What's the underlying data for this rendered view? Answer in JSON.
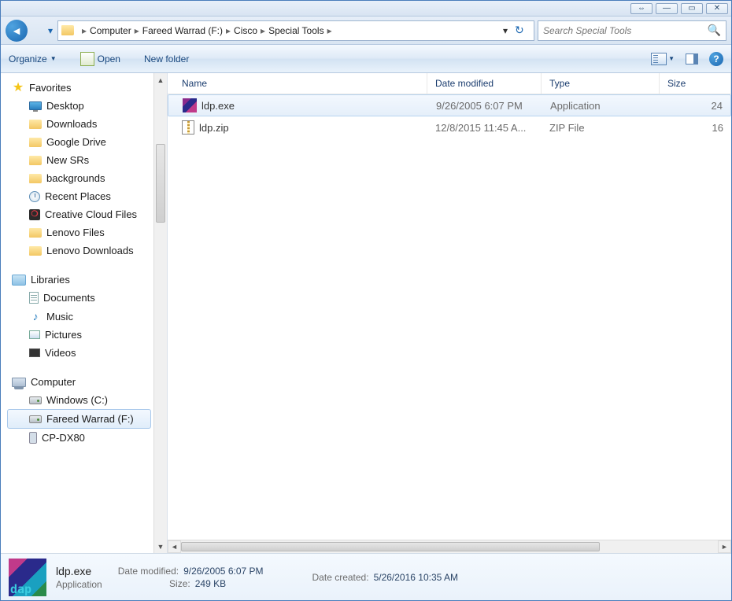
{
  "window": {
    "controls": {
      "expand": "⇔",
      "min": "—",
      "max": "▭",
      "close": "✕"
    }
  },
  "address": {
    "breadcrumbs": [
      "Computer",
      "Fareed Warrad (F:)",
      "Cisco",
      "Special Tools"
    ],
    "drop": "▾",
    "refresh": "↻"
  },
  "search": {
    "placeholder": "Search Special Tools",
    "icon": "🔍"
  },
  "toolbar": {
    "organize": "Organize",
    "open": "Open",
    "newfolder": "New folder",
    "drop": "▼"
  },
  "columns": {
    "name": "Name",
    "date": "Date modified",
    "type": "Type",
    "size": "Size"
  },
  "files": [
    {
      "name": "ldp.exe",
      "date": "9/26/2005 6:07 PM",
      "type": "Application",
      "size": "24",
      "selected": true,
      "icon": "ldp"
    },
    {
      "name": "ldp.zip",
      "date": "12/8/2015 11:45 A...",
      "type": "ZIP File",
      "size": "16",
      "selected": false,
      "icon": "zip"
    }
  ],
  "nav": {
    "favorites": {
      "label": "Favorites",
      "items": [
        {
          "label": "Desktop",
          "icon": "desktop"
        },
        {
          "label": "Downloads",
          "icon": "folder"
        },
        {
          "label": "Google Drive",
          "icon": "folder"
        },
        {
          "label": "New SRs",
          "icon": "folder"
        },
        {
          "label": "backgrounds",
          "icon": "folder"
        },
        {
          "label": "Recent Places",
          "icon": "recent"
        },
        {
          "label": "Creative Cloud Files",
          "icon": "cc"
        },
        {
          "label": "Lenovo Files",
          "icon": "folder"
        },
        {
          "label": "Lenovo Downloads",
          "icon": "folder"
        }
      ]
    },
    "libraries": {
      "label": "Libraries",
      "items": [
        {
          "label": "Documents",
          "icon": "doc"
        },
        {
          "label": "Music",
          "icon": "music"
        },
        {
          "label": "Pictures",
          "icon": "pic"
        },
        {
          "label": "Videos",
          "icon": "vid"
        }
      ]
    },
    "computer": {
      "label": "Computer",
      "items": [
        {
          "label": "Windows (C:)",
          "icon": "drive"
        },
        {
          "label": "Fareed Warrad (F:)",
          "icon": "drive",
          "selected": true
        },
        {
          "label": "CP-DX80",
          "icon": "phone"
        }
      ]
    }
  },
  "details": {
    "name": "ldp.exe",
    "type": "Application",
    "modified_label": "Date modified:",
    "modified_val": "9/26/2005 6:07 PM",
    "size_label": "Size:",
    "size_val": "249 KB",
    "created_label": "Date created:",
    "created_val": "5/26/2016 10:35 AM"
  }
}
